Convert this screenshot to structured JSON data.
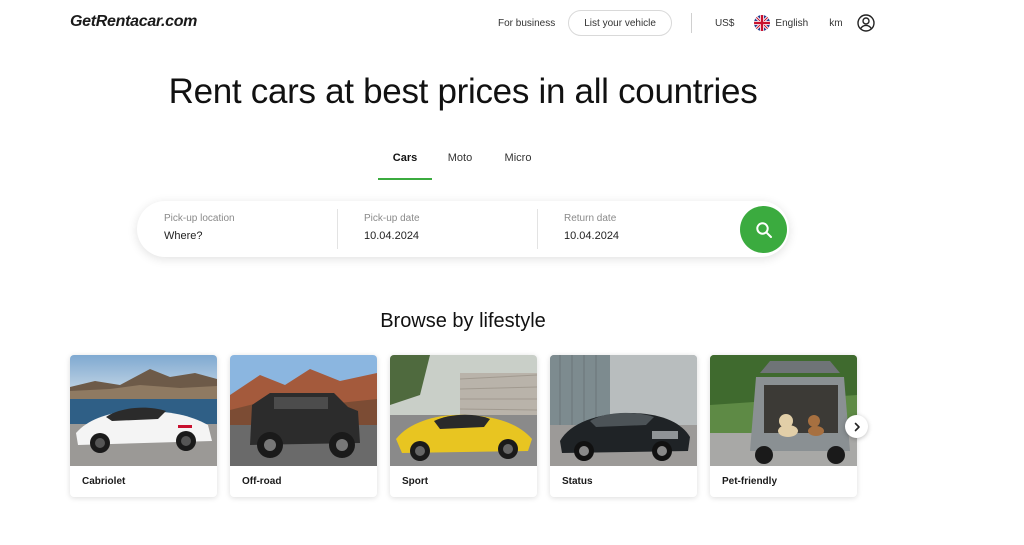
{
  "header": {
    "logo": "GetRentacar.com",
    "for_business": "For business",
    "list_vehicle": "List your vehicle",
    "currency": "US$",
    "language": "English",
    "units": "km"
  },
  "hero": {
    "title": "Rent cars at best prices in all countries"
  },
  "tabs": [
    {
      "label": "Cars",
      "active": true
    },
    {
      "label": "Moto",
      "active": false
    },
    {
      "label": "Micro",
      "active": false
    }
  ],
  "search": {
    "pickup_location": {
      "label": "Pick-up location",
      "value": "Where?"
    },
    "pickup_date": {
      "label": "Pick-up date",
      "value": "10.04.2024"
    },
    "return_date": {
      "label": "Return date",
      "value": "10.04.2024"
    }
  },
  "browse": {
    "title": "Browse by lifestyle",
    "cards": [
      {
        "label": "Cabriolet"
      },
      {
        "label": "Off-road"
      },
      {
        "label": "Sport"
      },
      {
        "label": "Status"
      },
      {
        "label": "Pet-friendly"
      }
    ]
  },
  "colors": {
    "accent": "#3bab3f",
    "text": "#1a1a1a",
    "muted": "#8a8a8a"
  },
  "icons": [
    "uk-flag-icon",
    "user-icon",
    "search-icon",
    "chevron-right-icon"
  ]
}
